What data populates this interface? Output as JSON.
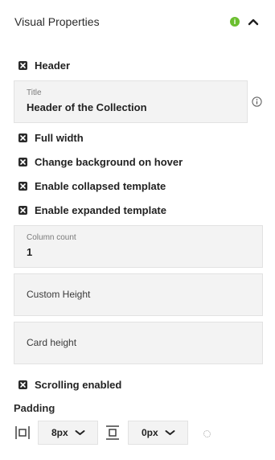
{
  "panel": {
    "title": "Visual Properties",
    "info_icon_glyph": "i"
  },
  "options": {
    "header": "Header",
    "full_width": "Full width",
    "change_bg_hover": "Change background on hover",
    "enable_collapsed": "Enable collapsed template",
    "enable_expanded": "Enable expanded template",
    "scrolling_enabled": "Scrolling enabled"
  },
  "fields": {
    "title": {
      "label": "Title",
      "value": "Header of the Collection"
    },
    "column_count": {
      "label": "Column count",
      "value": "1"
    },
    "custom_height": {
      "placeholder": "Custom Height"
    },
    "card_height": {
      "placeholder": "Card height"
    }
  },
  "padding": {
    "label": "Padding",
    "horizontal_value": "8px",
    "vertical_value": "0px"
  },
  "colors": {
    "accent_green": "#6bbf2f",
    "checkbox_fill": "#2a2a2a",
    "field_bg": "#f3f3f3"
  },
  "icons": {
    "info_green": "info-icon",
    "collapse": "chevron-up-icon",
    "checkbox": "checkbox-checked-icon",
    "tooltip": "info-outline-icon",
    "padding_horizontal": "padding-horizontal-icon",
    "padding_vertical": "padding-vertical-icon",
    "dropdown": "chevron-down-icon",
    "loading": "loading-spinner-icon"
  }
}
